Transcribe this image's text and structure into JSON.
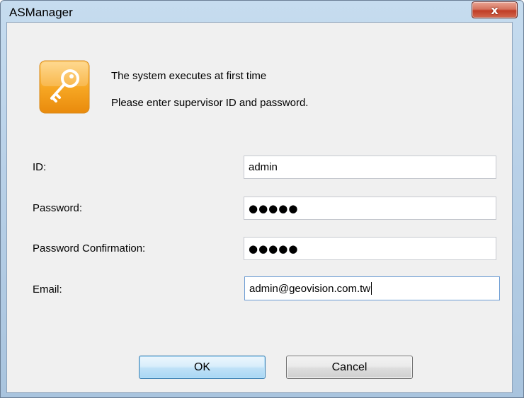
{
  "window": {
    "title": "ASManager",
    "close_glyph": "x"
  },
  "intro": {
    "line1": "The system executes at first time",
    "line2": "Please enter supervisor ID and password."
  },
  "fields": {
    "id": {
      "label": "ID:",
      "value": "admin"
    },
    "password": {
      "label": "Password:",
      "value": "●●●●●"
    },
    "password_confirmation": {
      "label": "Password Confirmation:",
      "value": "●●●●●"
    },
    "email": {
      "label": "Email:",
      "value": "admin@geovision.com.tw"
    }
  },
  "buttons": {
    "ok": "OK",
    "cancel": "Cancel"
  },
  "icons": {
    "app": "key-icon"
  },
  "colors": {
    "title_bar": "#b9d1e8",
    "close_button": "#c94a33",
    "key_icon": "#f4a623",
    "ok_button_border": "#3c7fb1"
  }
}
